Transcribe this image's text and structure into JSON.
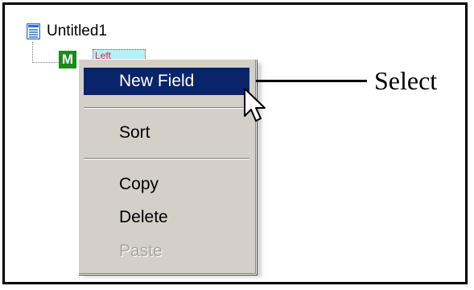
{
  "tree": {
    "root_label": "Untitled1",
    "child_icon_letter": "M",
    "child_label": "Left"
  },
  "context_menu": {
    "items": [
      {
        "label": "New Field",
        "state": "selected"
      },
      {
        "label": "Sort",
        "state": "normal"
      },
      {
        "label": "Copy",
        "state": "normal"
      },
      {
        "label": "Delete",
        "state": "normal"
      },
      {
        "label": "Paste",
        "state": "disabled"
      }
    ]
  },
  "annotation": {
    "callout_text": "Select"
  },
  "icons": {
    "root": "document-icon",
    "child": "m-node-icon",
    "pointer": "mouse-cursor-icon"
  },
  "colors": {
    "selection_bg": "#0a246a",
    "menu_bg": "#d4d0c8",
    "node_icon_bg": "#1c8b1c",
    "node_label_bg": "#b6f0f6",
    "node_label_text": "#d0303a",
    "disabled_text": "#a8a59c"
  }
}
